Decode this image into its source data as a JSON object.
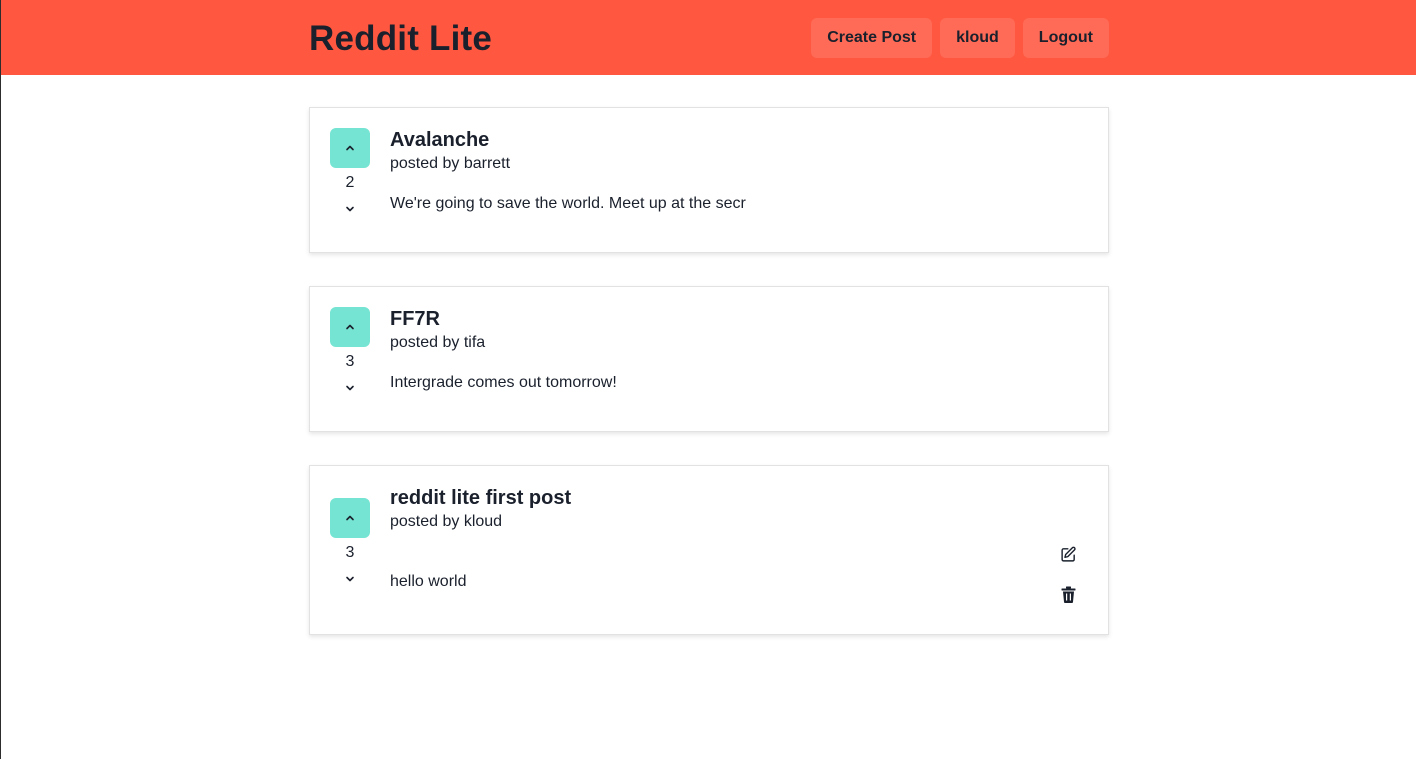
{
  "app": {
    "brand": "Reddit Lite"
  },
  "nav": {
    "create_post": "Create Post",
    "username": "kloud",
    "logout": "Logout"
  },
  "posts": [
    {
      "title": "Avalanche",
      "author": "posted by barrett",
      "score": "2",
      "body": "We're going to save the world. Meet up at the secr",
      "editable": false
    },
    {
      "title": "FF7R",
      "author": "posted by tifa",
      "score": "3",
      "body": "Intergrade comes out tomorrow!",
      "editable": false
    },
    {
      "title": "reddit lite first post",
      "author": "posted by kloud",
      "score": "3",
      "body": "hello world",
      "editable": true
    }
  ],
  "icons": {
    "upvote": "chevron-up-icon",
    "downvote": "chevron-down-icon",
    "edit": "edit-icon",
    "delete": "trash-icon"
  },
  "colors": {
    "navbar": "#ff5740",
    "nav_button": "#ff6b56",
    "upvote_button": "#76e4d2",
    "text": "#1a202c"
  }
}
